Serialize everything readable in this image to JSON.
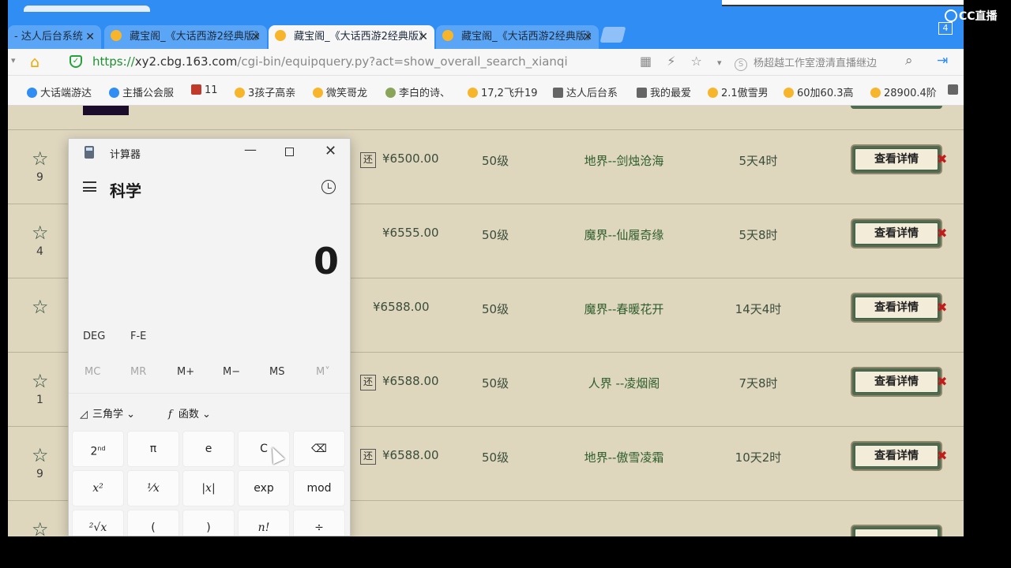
{
  "browser": {
    "tabs": [
      {
        "label": "- 达人后台系统",
        "active": false
      },
      {
        "label": "藏宝阁_《大话西游2经典版》",
        "active": false
      },
      {
        "label": "藏宝阁_《大话西游2经典版》",
        "active": true
      },
      {
        "label": "藏宝阁_《大话西游2经典版》",
        "active": false
      }
    ],
    "tab_close_glyph": "✕",
    "url_scheme": "https://",
    "url_host": "xy2.cbg.163.com",
    "url_path": "/cgi-bin/equipquery.py?act=show_overall_search_xianqi",
    "search_text": "杨超越工作室澄清直播继边",
    "bookmarks": [
      {
        "label": "大话端游达",
        "color": "#2f8df4"
      },
      {
        "label": "主播公会服",
        "color": "#2f8df4"
      },
      {
        "label": "11",
        "color": "#c0392b"
      },
      {
        "label": "3孩子高亲",
        "color": "#f7b52c"
      },
      {
        "label": "微笑哥龙",
        "color": "#f7b52c"
      },
      {
        "label": "李白的诗、",
        "color": "#8aa55a"
      },
      {
        "label": "17,2飞升19",
        "color": "#f7b52c"
      },
      {
        "label": "达人后台系",
        "color": "#666666"
      },
      {
        "label": "我的最爱",
        "color": "#666666"
      },
      {
        "label": "2.1傲雪男",
        "color": "#f7b52c"
      },
      {
        "label": "60加60.3高",
        "color": "#f7b52c"
      },
      {
        "label": "28900.4阶",
        "color": "#f7b52c"
      }
    ]
  },
  "listing": {
    "detail_label": "查看详情",
    "return_badge": "还",
    "rows": [
      {
        "count": "9",
        "returnable": true,
        "price": "¥6500.00",
        "level": "50级",
        "server": "地界--剑烛沧海",
        "time": "5天4时"
      },
      {
        "count": "4",
        "returnable": false,
        "price": "¥6555.00",
        "level": "50级",
        "server": "魔界--仙履奇缘",
        "time": "5天8时"
      },
      {
        "count": "",
        "returnable": false,
        "price": "¥6588.00",
        "level": "50级",
        "server": "魔界--春暖花开",
        "time": "14天4时"
      },
      {
        "count": "1",
        "returnable": true,
        "price": "¥6588.00",
        "level": "50级",
        "server": "人界 --凌烟阁",
        "time": "7天8时"
      },
      {
        "count": "9",
        "returnable": true,
        "price": "¥6588.00",
        "level": "50级",
        "server": "地界--傲雪凌霜",
        "time": "10天2时"
      }
    ]
  },
  "calculator": {
    "title": "计算器",
    "mode": "科学",
    "display": "0",
    "deg": "DEG",
    "fe": "F-E",
    "memory": [
      {
        "label": "MC",
        "enabled": false
      },
      {
        "label": "MR",
        "enabled": false
      },
      {
        "label": "M+",
        "enabled": true
      },
      {
        "label": "M−",
        "enabled": true
      },
      {
        "label": "MS",
        "enabled": true
      },
      {
        "label": "M˅",
        "enabled": false
      }
    ],
    "trig_label": "三角学",
    "func_label": "函数",
    "keys_row1": [
      "2nd",
      "π",
      "e",
      "C",
      "⌫"
    ],
    "keys_row2": [
      "x²",
      "¹⁄x",
      "|x|",
      "exp",
      "mod"
    ],
    "keys_row3": [
      "²√x",
      "(",
      ")",
      "n!",
      "÷"
    ]
  },
  "overlay": {
    "logo_text": "CC直播",
    "badge": "4"
  }
}
